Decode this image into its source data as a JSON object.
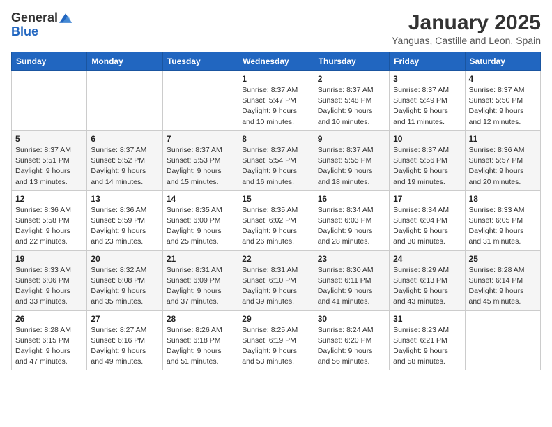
{
  "header": {
    "logo_general": "General",
    "logo_blue": "Blue",
    "month_title": "January 2025",
    "location": "Yanguas, Castille and Leon, Spain"
  },
  "days_of_week": [
    "Sunday",
    "Monday",
    "Tuesday",
    "Wednesday",
    "Thursday",
    "Friday",
    "Saturday"
  ],
  "weeks": [
    [
      {
        "day": "",
        "info": ""
      },
      {
        "day": "",
        "info": ""
      },
      {
        "day": "",
        "info": ""
      },
      {
        "day": "1",
        "info": "Sunrise: 8:37 AM\nSunset: 5:47 PM\nDaylight: 9 hours\nand 10 minutes."
      },
      {
        "day": "2",
        "info": "Sunrise: 8:37 AM\nSunset: 5:48 PM\nDaylight: 9 hours\nand 10 minutes."
      },
      {
        "day": "3",
        "info": "Sunrise: 8:37 AM\nSunset: 5:49 PM\nDaylight: 9 hours\nand 11 minutes."
      },
      {
        "day": "4",
        "info": "Sunrise: 8:37 AM\nSunset: 5:50 PM\nDaylight: 9 hours\nand 12 minutes."
      }
    ],
    [
      {
        "day": "5",
        "info": "Sunrise: 8:37 AM\nSunset: 5:51 PM\nDaylight: 9 hours\nand 13 minutes."
      },
      {
        "day": "6",
        "info": "Sunrise: 8:37 AM\nSunset: 5:52 PM\nDaylight: 9 hours\nand 14 minutes."
      },
      {
        "day": "7",
        "info": "Sunrise: 8:37 AM\nSunset: 5:53 PM\nDaylight: 9 hours\nand 15 minutes."
      },
      {
        "day": "8",
        "info": "Sunrise: 8:37 AM\nSunset: 5:54 PM\nDaylight: 9 hours\nand 16 minutes."
      },
      {
        "day": "9",
        "info": "Sunrise: 8:37 AM\nSunset: 5:55 PM\nDaylight: 9 hours\nand 18 minutes."
      },
      {
        "day": "10",
        "info": "Sunrise: 8:37 AM\nSunset: 5:56 PM\nDaylight: 9 hours\nand 19 minutes."
      },
      {
        "day": "11",
        "info": "Sunrise: 8:36 AM\nSunset: 5:57 PM\nDaylight: 9 hours\nand 20 minutes."
      }
    ],
    [
      {
        "day": "12",
        "info": "Sunrise: 8:36 AM\nSunset: 5:58 PM\nDaylight: 9 hours\nand 22 minutes."
      },
      {
        "day": "13",
        "info": "Sunrise: 8:36 AM\nSunset: 5:59 PM\nDaylight: 9 hours\nand 23 minutes."
      },
      {
        "day": "14",
        "info": "Sunrise: 8:35 AM\nSunset: 6:00 PM\nDaylight: 9 hours\nand 25 minutes."
      },
      {
        "day": "15",
        "info": "Sunrise: 8:35 AM\nSunset: 6:02 PM\nDaylight: 9 hours\nand 26 minutes."
      },
      {
        "day": "16",
        "info": "Sunrise: 8:34 AM\nSunset: 6:03 PM\nDaylight: 9 hours\nand 28 minutes."
      },
      {
        "day": "17",
        "info": "Sunrise: 8:34 AM\nSunset: 6:04 PM\nDaylight: 9 hours\nand 30 minutes."
      },
      {
        "day": "18",
        "info": "Sunrise: 8:33 AM\nSunset: 6:05 PM\nDaylight: 9 hours\nand 31 minutes."
      }
    ],
    [
      {
        "day": "19",
        "info": "Sunrise: 8:33 AM\nSunset: 6:06 PM\nDaylight: 9 hours\nand 33 minutes."
      },
      {
        "day": "20",
        "info": "Sunrise: 8:32 AM\nSunset: 6:08 PM\nDaylight: 9 hours\nand 35 minutes."
      },
      {
        "day": "21",
        "info": "Sunrise: 8:31 AM\nSunset: 6:09 PM\nDaylight: 9 hours\nand 37 minutes."
      },
      {
        "day": "22",
        "info": "Sunrise: 8:31 AM\nSunset: 6:10 PM\nDaylight: 9 hours\nand 39 minutes."
      },
      {
        "day": "23",
        "info": "Sunrise: 8:30 AM\nSunset: 6:11 PM\nDaylight: 9 hours\nand 41 minutes."
      },
      {
        "day": "24",
        "info": "Sunrise: 8:29 AM\nSunset: 6:13 PM\nDaylight: 9 hours\nand 43 minutes."
      },
      {
        "day": "25",
        "info": "Sunrise: 8:28 AM\nSunset: 6:14 PM\nDaylight: 9 hours\nand 45 minutes."
      }
    ],
    [
      {
        "day": "26",
        "info": "Sunrise: 8:28 AM\nSunset: 6:15 PM\nDaylight: 9 hours\nand 47 minutes."
      },
      {
        "day": "27",
        "info": "Sunrise: 8:27 AM\nSunset: 6:16 PM\nDaylight: 9 hours\nand 49 minutes."
      },
      {
        "day": "28",
        "info": "Sunrise: 8:26 AM\nSunset: 6:18 PM\nDaylight: 9 hours\nand 51 minutes."
      },
      {
        "day": "29",
        "info": "Sunrise: 8:25 AM\nSunset: 6:19 PM\nDaylight: 9 hours\nand 53 minutes."
      },
      {
        "day": "30",
        "info": "Sunrise: 8:24 AM\nSunset: 6:20 PM\nDaylight: 9 hours\nand 56 minutes."
      },
      {
        "day": "31",
        "info": "Sunrise: 8:23 AM\nSunset: 6:21 PM\nDaylight: 9 hours\nand 58 minutes."
      },
      {
        "day": "",
        "info": ""
      }
    ]
  ]
}
